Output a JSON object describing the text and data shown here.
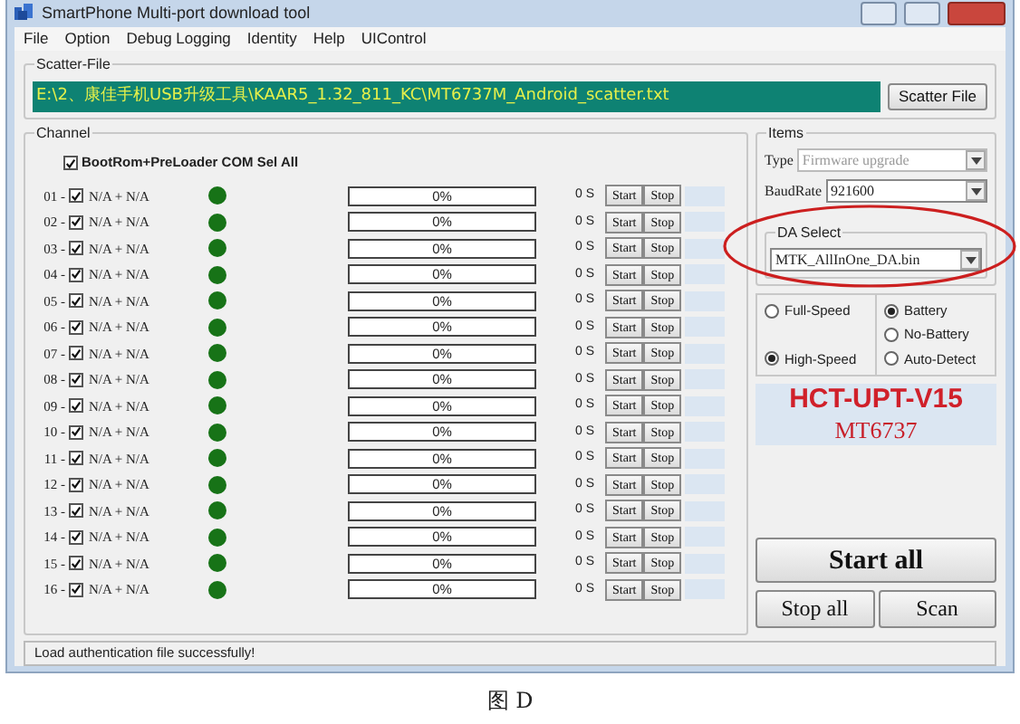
{
  "window": {
    "title": "SmartPhone Multi-port download tool"
  },
  "menu": [
    "File",
    "Option",
    "Debug Logging",
    "Identity",
    "Help",
    "UIControl"
  ],
  "scatter_file": {
    "label": "Scatter-File",
    "path": "E:\\2、康佳手机USB升级工具\\KAAR5_1.32_811_KC\\MT6737M_Android_scatter.txt",
    "button": "Scatter File"
  },
  "channel": {
    "label": "Channel",
    "select_all": {
      "label": "BootRom+PreLoader COM Sel All",
      "checked": true
    },
    "rows": [
      {
        "index": "01 -",
        "checked": true,
        "port": "N/A + N/A",
        "color": "#177317",
        "level": 0,
        "progress": "0%",
        "time": "0 S",
        "start": "Start",
        "stop": "Stop"
      },
      {
        "index": "02 -",
        "checked": true,
        "port": "N/A + N/A",
        "color": "#177317",
        "level": 0,
        "progress": "0%",
        "time": "0 S",
        "start": "Start",
        "stop": "Stop"
      },
      {
        "index": "03 -",
        "checked": true,
        "port": "N/A + N/A",
        "color": "#177317",
        "level": 0,
        "progress": "0%",
        "time": "0 S",
        "start": "Start",
        "stop": "Stop"
      },
      {
        "index": "04 -",
        "checked": true,
        "port": "N/A + N/A",
        "color": "#177317",
        "level": 0,
        "progress": "0%",
        "time": "0 S",
        "start": "Start",
        "stop": "Stop"
      },
      {
        "index": "05 -",
        "checked": true,
        "port": "N/A + N/A",
        "color": "#177317",
        "level": 0,
        "progress": "0%",
        "time": "0 S",
        "start": "Start",
        "stop": "Stop"
      },
      {
        "index": "06 -",
        "checked": true,
        "port": "N/A + N/A",
        "color": "#177317",
        "level": 0,
        "progress": "0%",
        "time": "0 S",
        "start": "Start",
        "stop": "Stop"
      },
      {
        "index": "07 -",
        "checked": true,
        "port": "N/A + N/A",
        "color": "#177317",
        "level": 0,
        "progress": "0%",
        "time": "0 S",
        "start": "Start",
        "stop": "Stop"
      },
      {
        "index": "08 -",
        "checked": true,
        "port": "N/A + N/A",
        "color": "#177317",
        "level": 0,
        "progress": "0%",
        "time": "0 S",
        "start": "Start",
        "stop": "Stop"
      },
      {
        "index": "09 -",
        "checked": true,
        "port": "N/A + N/A",
        "color": "#177317",
        "level": 0,
        "progress": "0%",
        "time": "0 S",
        "start": "Start",
        "stop": "Stop"
      },
      {
        "index": "10 -",
        "checked": true,
        "port": "N/A + N/A",
        "color": "#177317",
        "level": 0,
        "progress": "0%",
        "time": "0 S",
        "start": "Start",
        "stop": "Stop"
      },
      {
        "index": "11 -",
        "checked": true,
        "port": "N/A + N/A",
        "color": "#177317",
        "level": 0,
        "progress": "0%",
        "time": "0 S",
        "start": "Start",
        "stop": "Stop"
      },
      {
        "index": "12 -",
        "checked": true,
        "port": "N/A + N/A",
        "color": "#177317",
        "level": 0,
        "progress": "0%",
        "time": "0 S",
        "start": "Start",
        "stop": "Stop"
      },
      {
        "index": "13 -",
        "checked": true,
        "port": "N/A + N/A",
        "color": "#177317",
        "level": 0,
        "progress": "0%",
        "time": "0 S",
        "start": "Start",
        "stop": "Stop"
      },
      {
        "index": "14 -",
        "checked": true,
        "port": "N/A + N/A",
        "color": "#177317",
        "level": 0,
        "progress": "0%",
        "time": "0 S",
        "start": "Start",
        "stop": "Stop"
      },
      {
        "index": "15 -",
        "checked": true,
        "port": "N/A + N/A",
        "color": "#177317",
        "level": 0,
        "progress": "0%",
        "time": "0 S",
        "start": "Start",
        "stop": "Stop"
      },
      {
        "index": "16 -",
        "checked": true,
        "port": "N/A + N/A",
        "color": "#177317",
        "level": 0,
        "progress": "0%",
        "time": "0 S",
        "start": "Start",
        "stop": "Stop"
      }
    ]
  },
  "items": {
    "label": "Items",
    "type_label": "Type",
    "type_value": "Firmware upgrade",
    "type_disabled": true,
    "baudrate_label": "BaudRate",
    "baudrate": "921600",
    "da_label": "DA Select",
    "da_value": "MTK_AllInOne_DA.bin"
  },
  "speed": [
    {
      "label": "Full-Speed",
      "selected": false
    },
    {
      "label": "High-Speed",
      "selected": true
    }
  ],
  "battery": [
    {
      "label": "Battery",
      "selected": true
    },
    {
      "label": "No-Battery",
      "selected": false
    },
    {
      "label": "Auto-Detect",
      "selected": false
    }
  ],
  "banner": {
    "title": "HCT-UPT-V15",
    "subtitle": "MT6737"
  },
  "buttons": {
    "start_all": "Start all",
    "stop_all": "Stop all",
    "scan": "Scan"
  },
  "status_bar": "Load authentication file successfully!",
  "caption": "图 D"
}
